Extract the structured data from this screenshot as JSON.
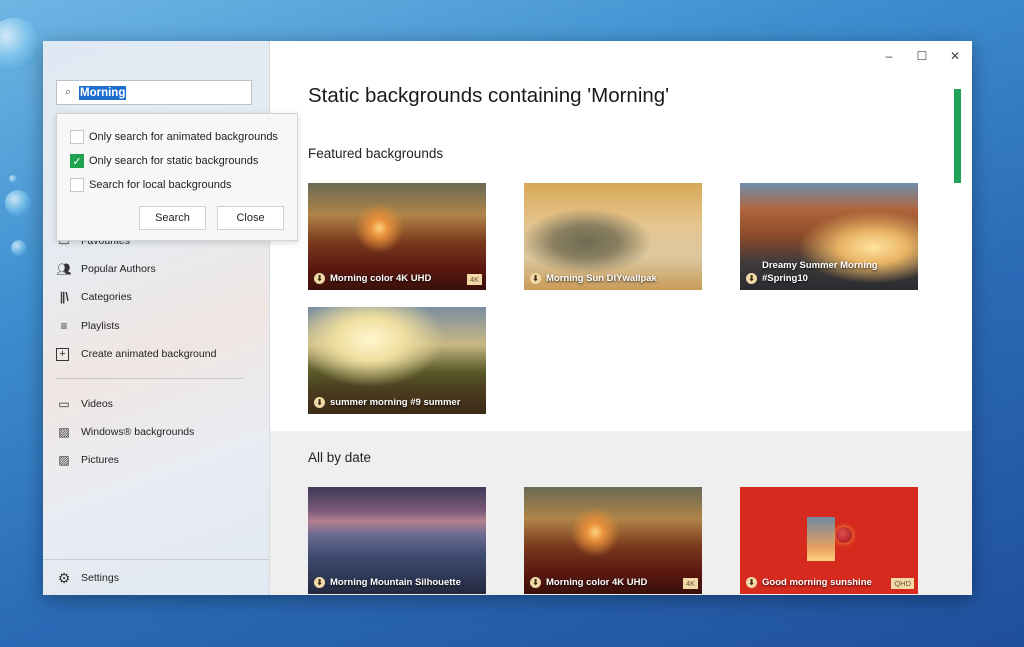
{
  "search": {
    "value": "Morning",
    "icon": "search-icon"
  },
  "search_options": {
    "options": [
      {
        "label": "Only search for animated backgrounds",
        "checked": false
      },
      {
        "label": "Only search for static backgrounds",
        "checked": true
      },
      {
        "label": "Search for local backgrounds",
        "checked": false
      }
    ],
    "search_label": "Search",
    "close_label": "Close"
  },
  "sidebar": {
    "items": [
      {
        "label": "Favourites",
        "icon": "favourites-icon"
      },
      {
        "label": "Popular Authors",
        "icon": "authors-icon"
      },
      {
        "label": "Categories",
        "icon": "categories-icon"
      },
      {
        "label": "Playlists",
        "icon": "playlists-icon"
      },
      {
        "label": "Create animated background",
        "icon": "add-icon"
      }
    ],
    "local_items": [
      {
        "label": "Videos",
        "icon": "video-icon"
      },
      {
        "label": "Windows® backgrounds",
        "icon": "image-icon"
      },
      {
        "label": "Pictures",
        "icon": "image-icon"
      }
    ],
    "settings_label": "Settings"
  },
  "window_controls": {
    "minimize": "–",
    "maximize": "☐",
    "close": "✕"
  },
  "main": {
    "title": "Static backgrounds containing 'Morning'",
    "featured_title": "Featured backgrounds",
    "featured": [
      {
        "title": "Morning color 4K UHD",
        "badge": "4K"
      },
      {
        "title": "Morning Sun DIYwallpak",
        "badge": ""
      },
      {
        "title": "Dreamy Summer Morning #Spring10",
        "badge": ""
      },
      {
        "title": "summer morning #9 summer",
        "badge": ""
      }
    ],
    "all_title": "All by date",
    "all": [
      {
        "title": "Morning Mountain Silhouette",
        "badge": ""
      },
      {
        "title": "Morning color 4K UHD",
        "badge": "4K"
      },
      {
        "title": "Good morning sunshine",
        "badge": "QHD"
      }
    ]
  },
  "colors": {
    "accent": "#1fa35a",
    "checkbox": "#1fa34f",
    "selection": "#1e6fd0"
  }
}
